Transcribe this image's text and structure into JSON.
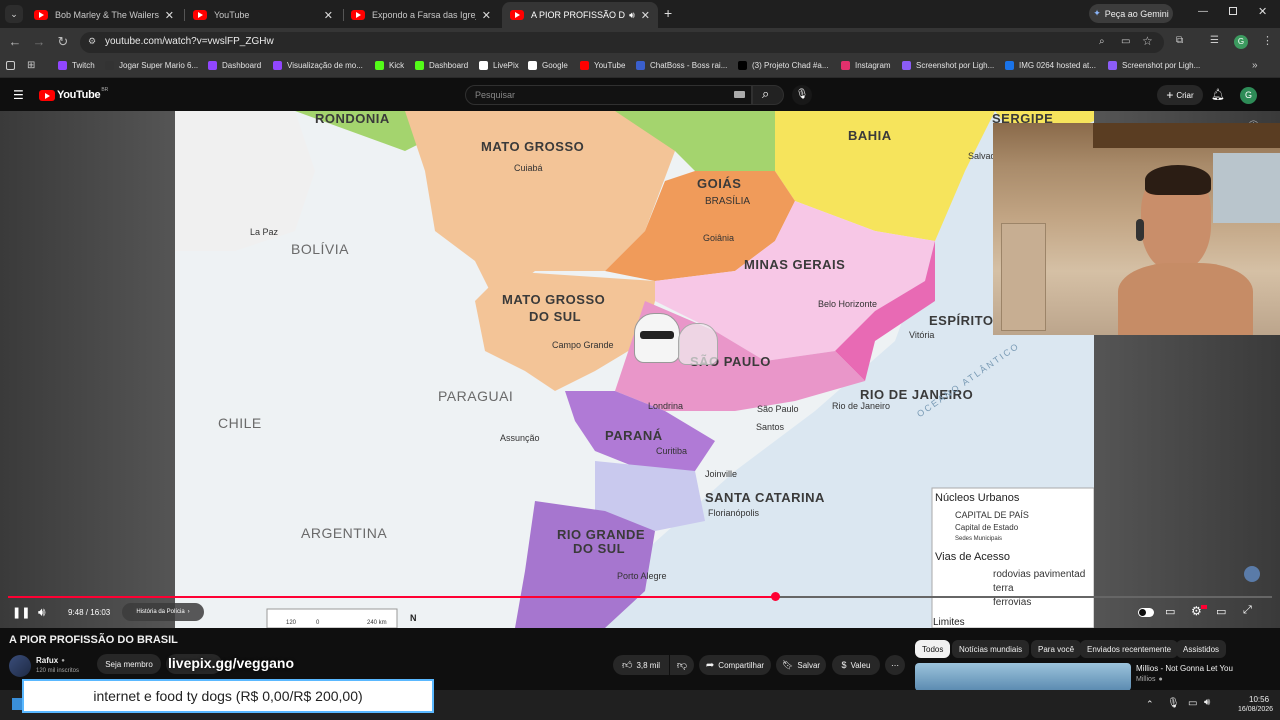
{
  "browser": {
    "tabs": [
      {
        "title": "Bob Marley & The Wailers - Exo",
        "active": false
      },
      {
        "title": "YouTube",
        "active": false
      },
      {
        "title": "Expondo a Farsa das Igrejas Ev",
        "active": false
      },
      {
        "title": "A PIOR PROFISSÃO DO BRAS",
        "active": true
      }
    ],
    "gemini_label": "Peça ao Gemini",
    "url": "youtube.com/watch?v=vwslFP_ZGHw",
    "profile_initial": "G",
    "bookmarks": [
      {
        "label": "Twitch",
        "color": "#9146ff"
      },
      {
        "label": "Jogar Super Mario 6...",
        "color": "#333333"
      },
      {
        "label": "Dashboard",
        "color": "#9146ff"
      },
      {
        "label": "Visualização de mo...",
        "color": "#9146ff"
      },
      {
        "label": "Kick",
        "color": "#53fc18"
      },
      {
        "label": "Dashboard",
        "color": "#53fc18"
      },
      {
        "label": "LivePix",
        "color": "#ffffff"
      },
      {
        "label": "Google",
        "color": "#ffffff"
      },
      {
        "label": "YouTube",
        "color": "#ff0000"
      },
      {
        "label": "ChatBoss - Boss rai...",
        "color": "#3a5fcd"
      },
      {
        "label": "(3) Projeto Chad #a...",
        "color": "#000000"
      },
      {
        "label": "Instagram",
        "color": "#e1306c"
      },
      {
        "label": "Screenshot por Ligh...",
        "color": "#8b5cf6"
      },
      {
        "label": "IMG 0264 hosted at...",
        "color": "#1a73e8"
      },
      {
        "label": "Screenshot por Ligh...",
        "color": "#8b5cf6"
      }
    ]
  },
  "youtube": {
    "logo_text": "YouTube",
    "logo_sup": "BR",
    "search_placeholder": "Pesquisar",
    "create_label": "Criar",
    "avatar_initial": "G"
  },
  "map": {
    "states": [
      "RONDONIA",
      "MATO GROSSO",
      "BAHIA",
      "SERGIPE",
      "GOIÁS",
      "BRASÍLIA",
      "MINAS GERAIS",
      "MATO GROSSO",
      "DO SUL",
      "ESPÍRITO",
      "SÃO PAULO",
      "RIO DE JANEIRO",
      "PARANÁ",
      "SANTA CATARINA",
      "RIO GRANDE",
      "DO SUL"
    ],
    "countries": [
      "BOLÍVIA",
      "PARAGUAI",
      "CHILE",
      "ARGENTINA"
    ],
    "cities": [
      "Cuiabá",
      "Goiânia",
      "Campo Grande",
      "Belo Horizonte",
      "Vitória",
      "Rio de Janeiro",
      "São Paulo",
      "Curitiba",
      "Florianópolis",
      "Porto Alegre",
      "Assunção",
      "La Paz",
      "Salvador",
      "Santos",
      "Londrina",
      "Joinville"
    ],
    "ocean": "OCEANO ATLÂNTICO",
    "legend": {
      "title1": "Núcleos Urbanos",
      "item1": "CAPITAL DE PAÍS",
      "item2": "Capital de Estado",
      "item3": "Sedes Municipais",
      "title2": "Vias de Acesso",
      "item4": "rodovias pavimentad",
      "item5": "terra",
      "item6": "ferrovias",
      "title3": "Limites"
    },
    "scale": {
      "a": "120",
      "b": "0",
      "c": "240 km",
      "north": "N"
    }
  },
  "player": {
    "time": "9:48 / 16:03",
    "chapter": "História da Polícia",
    "progress": 0.607
  },
  "video": {
    "title": "A PIOR PROFISSÃO DO BRASIL",
    "channel": "Rafux",
    "subs": "120 mil inscritos",
    "member_label": "Seja membro",
    "likes": "3,8 mil",
    "share_label": "Compartilhar",
    "save_label": "Salvar",
    "thanks_label": "Valeu"
  },
  "chips": [
    "Todos",
    "Notícias mundiais",
    "Para você",
    "Enviados recentemente",
    "Assistidos"
  ],
  "recommendation": {
    "title": "Millios - Not Gonna Let You",
    "channel": "Millios"
  },
  "stream_overlay": {
    "url_text": "livepix.gg/veggano",
    "goal_text": "internet e food ty dogs (R$ 0,00/R$ 200,00)"
  },
  "taskbar": {
    "time": "10:56",
    "date": "16/08/2026"
  }
}
